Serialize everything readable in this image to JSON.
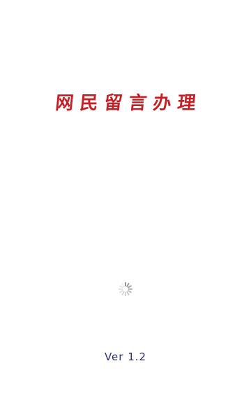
{
  "splash": {
    "title": "网民留言办理",
    "version": "Ver 1.2"
  },
  "loading": {
    "icon": "loading-spinner-icon"
  },
  "colors": {
    "title": "#c81f25",
    "version": "#2b2d7a",
    "spinner": "#8a8a8a",
    "background": "#ffffff"
  }
}
